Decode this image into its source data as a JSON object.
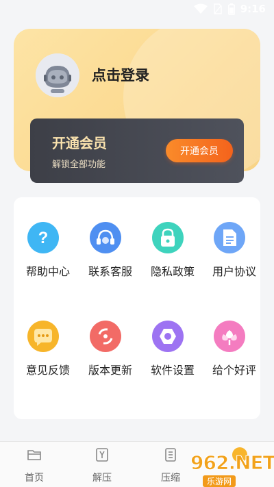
{
  "status_bar": {
    "time": "9:16"
  },
  "profile": {
    "login_text": "点击登录"
  },
  "vip": {
    "title": "开通会员",
    "subtitle": "解锁全部功能",
    "button_label": "开通会员"
  },
  "menu": {
    "items": [
      {
        "label": "帮助中心",
        "icon": "help-icon",
        "color": "#3fb6f4"
      },
      {
        "label": "联系客服",
        "icon": "customer-service-icon",
        "color": "#4f8ff1"
      },
      {
        "label": "隐私政策",
        "icon": "lock-icon",
        "color": "#3ed3bd"
      },
      {
        "label": "用户协议",
        "icon": "document-icon",
        "color": "#6ea6f7"
      },
      {
        "label": "意见反馈",
        "icon": "feedback-icon",
        "color": "#f7b52a"
      },
      {
        "label": "版本更新",
        "icon": "update-icon",
        "color": "#f26b66"
      },
      {
        "label": "软件设置",
        "icon": "settings-icon",
        "color": "#9d73f2"
      },
      {
        "label": "给个好评",
        "icon": "flower-icon",
        "color": "#f47cc0"
      }
    ]
  },
  "tabs": [
    {
      "label": "首页",
      "icon": "folder-icon"
    },
    {
      "label": "解压",
      "icon": "unzip-icon"
    },
    {
      "label": "压缩",
      "icon": "archive-icon"
    }
  ],
  "watermark": {
    "top": "962.NET",
    "bottom": "乐游网"
  }
}
